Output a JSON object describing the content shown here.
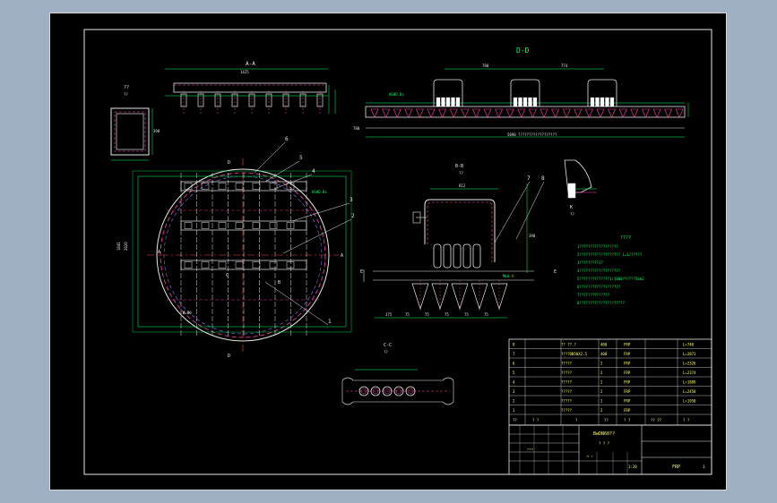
{
  "views": {
    "aa": {
      "title": "A-A",
      "dim_top": "1425",
      "label_v": "??"
    },
    "dd": {
      "title": "D-D",
      "dim_a": "780",
      "dim_b": "774",
      "note": "HSHD.Bs",
      "dim_len": "590",
      "dim_total": "5890 ??????????????????",
      "dim_left": "780",
      "part": "7"
    },
    "section_small": {
      "title": "??",
      "label": "??",
      "dim": "390"
    },
    "bb": {
      "title": "B-B",
      "sub": "??",
      "dim_w": "812",
      "dim_side": "390",
      "e_left": "E",
      "e_right": "E",
      "part7": "7",
      "part8": "8",
      "dims_bottom": [
        "375",
        "75",
        "75",
        "75",
        "75",
        "75"
      ],
      "note": "Mmm.h"
    },
    "kk": {
      "title": "K",
      "sub": "??"
    },
    "cc": {
      "title": "C-C",
      "sub": "??"
    },
    "plan": {
      "parts": [
        "6",
        "5",
        "4",
        "3",
        "2",
        "1"
      ],
      "d_top": "D",
      "d_bottom": "D",
      "a_left": "A",
      "a_right": "A",
      "b": "B",
      "c": "C",
      "dim_left": "1841",
      "dim_left2": "2820",
      "note_tr": "HSHD.Bs",
      "note_l": "Ø=80"
    }
  },
  "notes": {
    "title": "????",
    "lines": [
      "1??????????????????",
      "2??????????????????? L=1/?????",
      "3?????????3?",
      "4???????????????????",
      "  5??????????????1/1000??????5mm2",
      "6???????????????????",
      "7??????????????",
      "8?????????????????????"
    ]
  },
  "bom": {
    "rows": [
      {
        "no": "8",
        "name": "?? ??.?",
        "qty": "400",
        "mat": "FRP",
        "remark": "L=740"
      },
      {
        "no": "7",
        "name": "????DN50X2.5",
        "qty": "400",
        "mat": "FRP",
        "remark": "L=2871"
      },
      {
        "no": "6",
        "name": "?????",
        "qty": "2",
        "mat": "FRP",
        "remark": "L=2326"
      },
      {
        "no": "5",
        "name": "?????",
        "qty": "2",
        "mat": "FRP",
        "remark": "L=2374"
      },
      {
        "no": "4",
        "name": "?????",
        "qty": "2",
        "mat": "FRP",
        "remark": "L=1889"
      },
      {
        "no": "3",
        "name": "?????",
        "qty": "2",
        "mat": "FRP",
        "remark": "L=2458"
      },
      {
        "no": "2",
        "name": "?????",
        "qty": "1",
        "mat": "FRP",
        "remark": "L=1950"
      },
      {
        "no": "1",
        "name": "?????",
        "qty": "2",
        "mat": "FRP",
        "remark": ""
      }
    ],
    "header": {
      "no": "??",
      "code": "?  ?",
      "name": "?",
      "qty": "??",
      "mat": "?  ?",
      "wt": "?? ??",
      "remark": "?  ?"
    }
  },
  "title_block": {
    "drawing_title": "BwDN60??",
    "sub": "? ? ?",
    "scale": "1:20",
    "material": "FRP",
    "sheet": "1",
    "label_a": "????",
    "label_b": "?? ?"
  }
}
